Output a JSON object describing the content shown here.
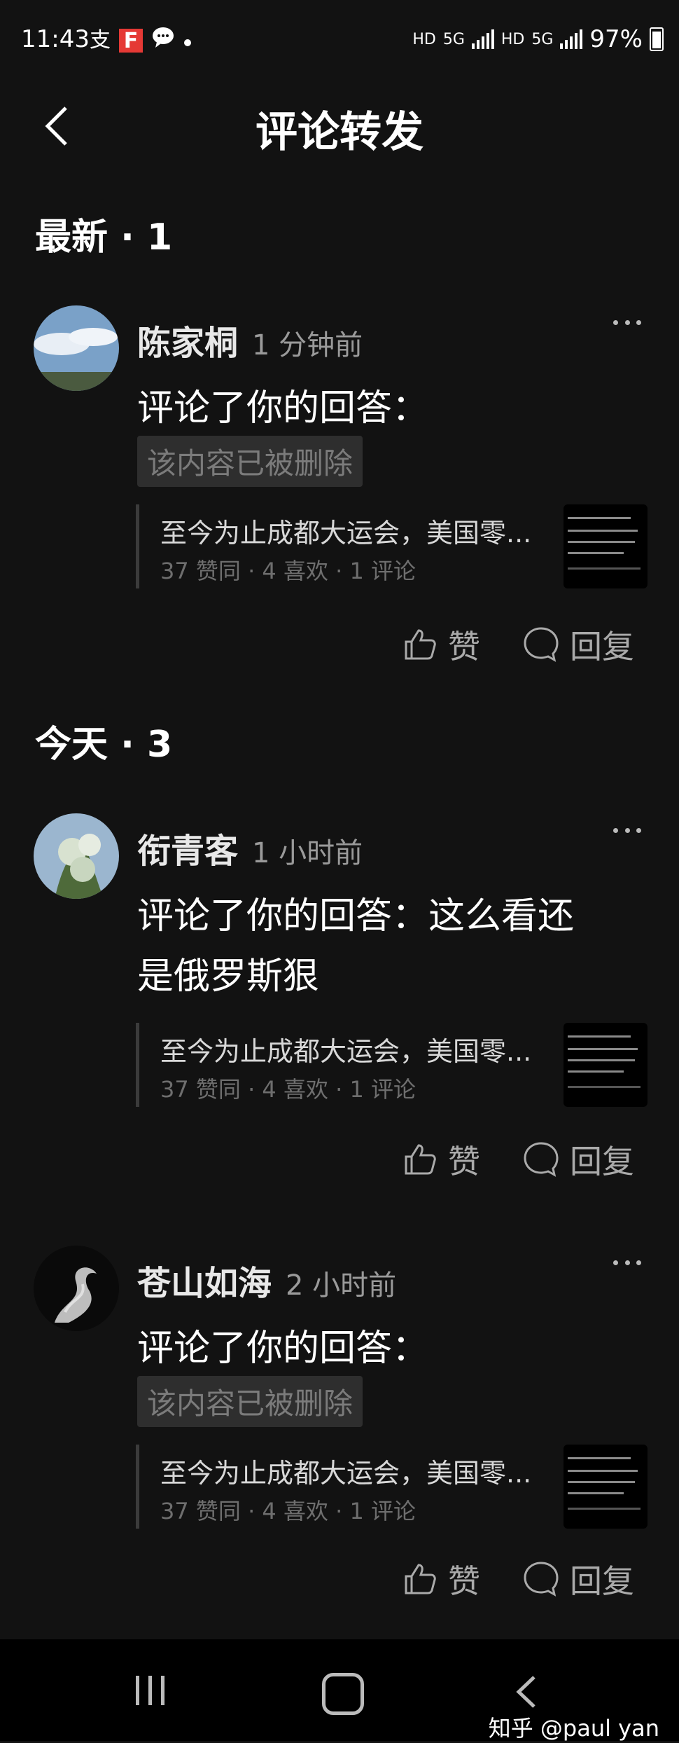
{
  "status_bar": {
    "time": "11:43",
    "notification_icons": [
      "alipay-icon",
      "flipboard-icon",
      "message-icon",
      "dot-icon"
    ],
    "network_labels": [
      "HD",
      "5G",
      "HD",
      "5G"
    ],
    "battery": "97%"
  },
  "header": {
    "title": "评论转发",
    "back_icon": "chevron-left-icon"
  },
  "sections": {
    "latest": "最新 · 1",
    "today": "今天 · 3"
  },
  "comments": [
    {
      "user": "陈家桐",
      "time": "1 分钟前",
      "text": "评论了你的回答：",
      "deleted_label": "该内容已被删除",
      "quote_title": "至今为止成都大运会，美国零...",
      "quote_stats": "37 赞同 · 4 喜欢 · 1 评论",
      "like_label": "赞",
      "reply_label": "回复"
    },
    {
      "user": "衔青客",
      "time": "1 小时前",
      "text_line1": "评论了你的回答：这么看还",
      "text_line2": "是俄罗斯狠",
      "quote_title": "至今为止成都大运会，美国零...",
      "quote_stats": "37 赞同 · 4 喜欢 · 1 评论",
      "like_label": "赞",
      "reply_label": "回复"
    },
    {
      "user": "苍山如海",
      "time": "2 小时前",
      "text": "评论了你的回答：",
      "deleted_label": "该内容已被删除",
      "quote_title": "至今为止成都大运会，美国零...",
      "quote_stats": "37 赞同 · 4 喜欢 · 1 评论",
      "like_label": "赞",
      "reply_label": "回复"
    }
  ],
  "bottom_nav": {
    "recent_icon": "recent-apps-icon",
    "home_icon": "home-icon",
    "back_icon": "back-icon"
  },
  "watermark": "知乎 @paul yan",
  "colors": {
    "background": "#121212",
    "text": "#ffffff",
    "muted": "#9a9a9a",
    "deleted_bg": "#2e2e2e"
  }
}
